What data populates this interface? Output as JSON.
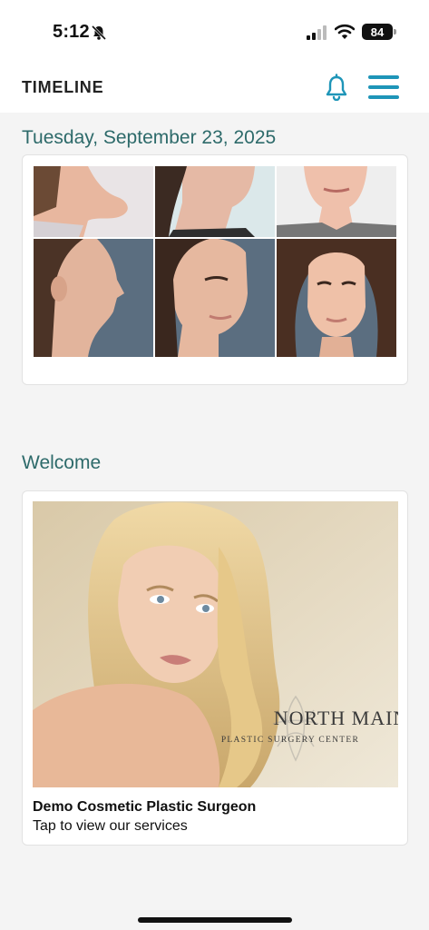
{
  "status_bar": {
    "time": "5:12",
    "battery": "84",
    "icons": [
      "bell-slash-icon",
      "cellular-signal-icon",
      "wifi-icon",
      "battery-icon"
    ]
  },
  "header": {
    "title": "TIMELINE",
    "icons": [
      "bell-icon",
      "hamburger-menu-icon"
    ],
    "accent_color": "#1e95b8"
  },
  "timeline": {
    "date_heading": "Tuesday, September 23, 2025",
    "welcome_heading": "Welcome",
    "heading_color": "#2d6a6a"
  },
  "welcome_card": {
    "title": "Demo Cosmetic Plastic Surgeon",
    "subtitle": "Tap to view our services",
    "brand_line1": "NORTH MAIN",
    "brand_line2": "PLASTIC SURGERY CENTER"
  }
}
